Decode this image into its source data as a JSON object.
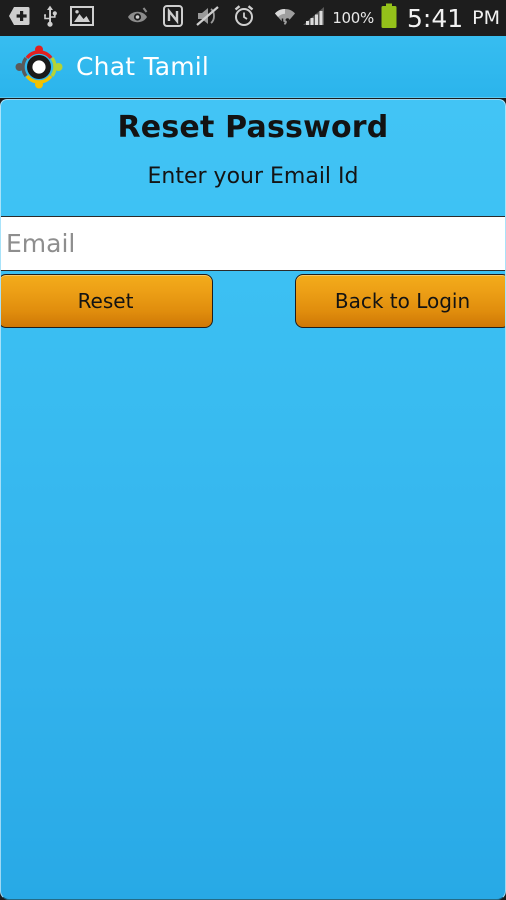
{
  "status_bar": {
    "icons": [
      {
        "name": "add-to-home-icon",
        "label": "add"
      },
      {
        "name": "usb-icon",
        "label": "usb"
      },
      {
        "name": "screenshot-image-icon",
        "label": "image"
      },
      {
        "name": "smart-stay-eye-icon",
        "label": "eye"
      },
      {
        "name": "nfc-icon",
        "label": "nfc"
      },
      {
        "name": "sound-muted-icon",
        "label": "muted"
      },
      {
        "name": "alarm-clock-icon",
        "label": "alarm"
      },
      {
        "name": "wifi-icon",
        "label": "wifi"
      },
      {
        "name": "cellular-signal-icon",
        "label": "signal"
      }
    ],
    "battery_percent": "100%",
    "battery_color": "#94c11a",
    "time": "5:41",
    "am_pm": "PM"
  },
  "app_bar": {
    "title": "Chat Tamil",
    "logo_name": "chat-tamil-logo",
    "background_color": "#2bb4ec",
    "title_color": "#ffffff",
    "logo_colors": {
      "top_dot": "#e02020",
      "left_dot": "#5a5a5a",
      "right_dot": "#b5d334",
      "bottom_dot": "#f2c200",
      "top_arc": "#e02020",
      "left_arc": "#5a5a5a",
      "right_arc": "#b5d334",
      "bottom_arc": "#f2c200",
      "ring": "#1a1a1a",
      "center": "#ffffff"
    }
  },
  "content": {
    "heading": "Reset Password",
    "subheading": "Enter your Email Id",
    "background_color": "#3cc0f3",
    "heading_color": "#131313"
  },
  "form": {
    "email_placeholder": "Email",
    "email_value": ""
  },
  "actions": {
    "reset_label": "Reset",
    "back_to_login_label": "Back to Login",
    "button_color_top": "#f3ac1b",
    "button_color_bottom": "#cf7806",
    "button_text_color": "#131313"
  }
}
